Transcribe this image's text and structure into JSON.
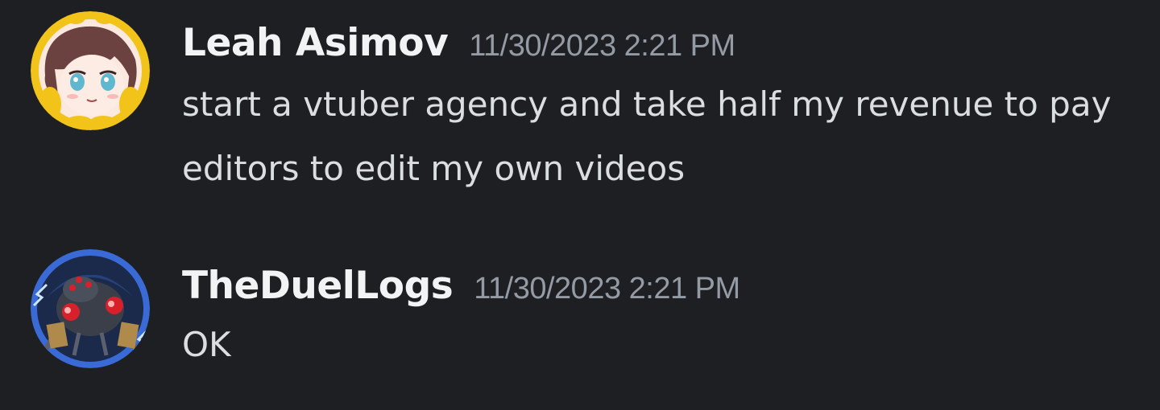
{
  "messages": [
    {
      "username": "Leah Asimov",
      "timestamp": "11/30/2023 2:21 PM",
      "content": "start a vtuber agency and take half my revenue to pay editors to edit my own videos",
      "avatar_icon": "anime-girl-avatar-icon"
    },
    {
      "username": "TheDuelLogs",
      "timestamp": "11/30/2023 2:21 PM",
      "content": "OK",
      "avatar_icon": "spider-creature-avatar-icon"
    }
  ],
  "colors": {
    "background": "#1e1f22",
    "username": "#f2f3f5",
    "timestamp": "#949ba4",
    "message_text": "#dbdee1"
  }
}
